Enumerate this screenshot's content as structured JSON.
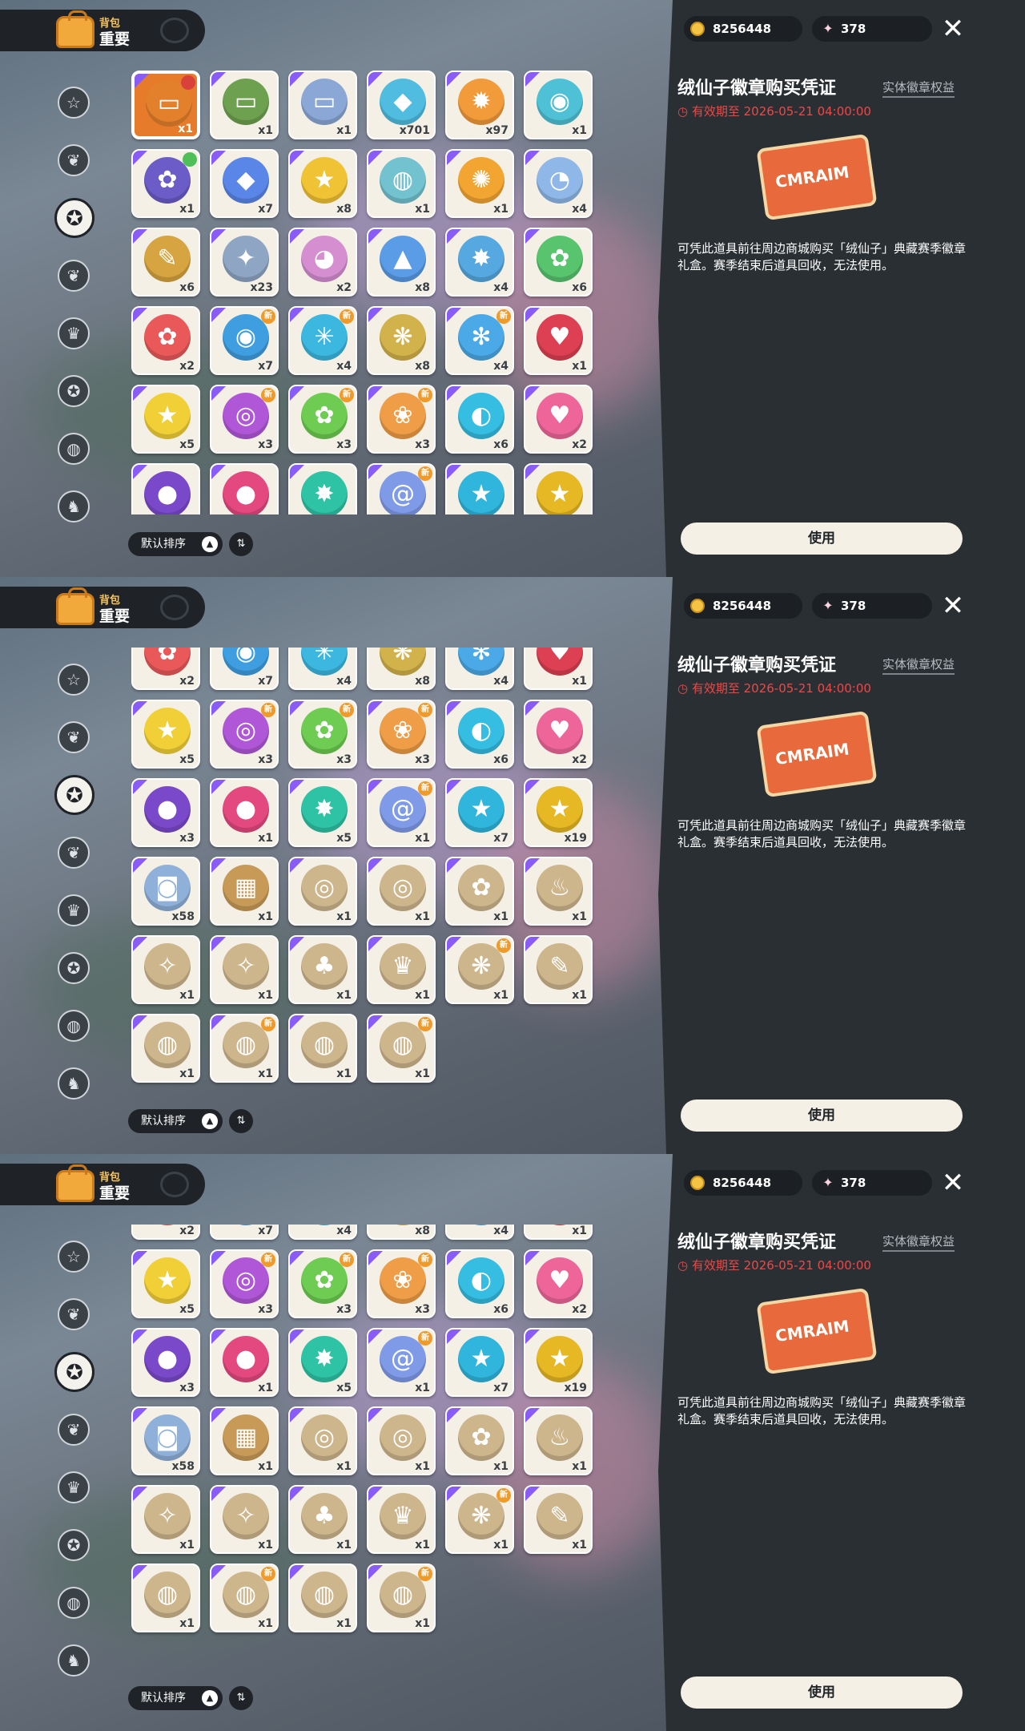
{
  "header": {
    "bag_label": "背包",
    "category": "重要"
  },
  "currency": {
    "coins": "8256448",
    "gems": "378"
  },
  "close_icon": "✕",
  "sort": {
    "label": "默认排序",
    "arrow": "▲",
    "order_icon": "⇅"
  },
  "detail": {
    "title": "绒仙子徽章购买凭证",
    "tag": "实体徽章权益",
    "expire": "有效期至 2026-05-21 04:00:00",
    "art_label": "CMRAIM",
    "description": "可凭此道具前往周边商城购买「绒仙子」典藏赛季徽章礼盒。赛季结束后道具回收，无法使用。",
    "use_button": "使用"
  },
  "sidebar_icons": [
    "☆",
    "❦",
    "✪",
    "❦",
    "♛",
    "✪",
    "◍",
    "♞"
  ],
  "rows": [
    {
      "items": [
        {
          "c": "#e3802c",
          "i": "▭",
          "n": "x1",
          "sel": true,
          "b": "red"
        },
        {
          "c": "#6ea14f",
          "i": "▭",
          "n": "x1"
        },
        {
          "c": "#8aa7d6",
          "i": "▭",
          "n": "x1"
        },
        {
          "c": "#4fbce0",
          "i": "◆",
          "n": "x701"
        },
        {
          "c": "#f19b3a",
          "i": "✹",
          "n": "x97"
        },
        {
          "c": "#4fc1d6",
          "i": "◉",
          "n": "x1"
        }
      ]
    },
    {
      "items": [
        {
          "c": "#6b5cc8",
          "i": "✿",
          "n": "x1",
          "b": "green"
        },
        {
          "c": "#5a86e8",
          "i": "◆",
          "n": "x7"
        },
        {
          "c": "#f0c334",
          "i": "★",
          "n": "x8"
        },
        {
          "c": "#72c2cf",
          "i": "◍",
          "n": "x1"
        },
        {
          "c": "#f3a532",
          "i": "✺",
          "n": "x1"
        },
        {
          "c": "#8fb8e8",
          "i": "◔",
          "n": "x4"
        }
      ]
    },
    {
      "items": [
        {
          "c": "#d6a440",
          "i": "✎",
          "n": "x6"
        },
        {
          "c": "#8ea5c4",
          "i": "✦",
          "n": "x23"
        },
        {
          "c": "#d58fd1",
          "i": "◕",
          "n": "x2"
        },
        {
          "c": "#5a9ce6",
          "i": "▲",
          "n": "x8"
        },
        {
          "c": "#55a8e0",
          "i": "✸",
          "n": "x4"
        },
        {
          "c": "#58c46e",
          "i": "✿",
          "n": "x6"
        }
      ]
    },
    {
      "items": [
        {
          "c": "#e9595a",
          "i": "✿",
          "n": "x2"
        },
        {
          "c": "#3f9ee0",
          "i": "◉",
          "n": "x7",
          "b": "new"
        },
        {
          "c": "#3cb8e0",
          "i": "✳",
          "n": "x4",
          "b": "new"
        },
        {
          "c": "#d2b24a",
          "i": "❋",
          "n": "x8"
        },
        {
          "c": "#4aa9e6",
          "i": "✻",
          "n": "x4",
          "b": "new"
        },
        {
          "c": "#dc4052",
          "i": "♥",
          "n": "x1"
        }
      ]
    },
    {
      "items": [
        {
          "c": "#f1cf37",
          "i": "★",
          "n": "x5"
        },
        {
          "c": "#b057d8",
          "i": "◎",
          "n": "x3",
          "b": "new"
        },
        {
          "c": "#6ecc52",
          "i": "✿",
          "n": "x3",
          "b": "new"
        },
        {
          "c": "#ef9d46",
          "i": "❀",
          "n": "x3",
          "b": "new"
        },
        {
          "c": "#36bde2",
          "i": "◐",
          "n": "x6"
        },
        {
          "c": "#ee6699",
          "i": "♥",
          "n": "x2"
        }
      ]
    },
    {
      "items": [
        {
          "c": "#7a49c9",
          "i": "●",
          "n": "x3"
        },
        {
          "c": "#e3487e",
          "i": "●",
          "n": "x1"
        },
        {
          "c": "#2fc3a6",
          "i": "✸",
          "n": "x5"
        },
        {
          "c": "#7f9be8",
          "i": "@",
          "n": "x1",
          "b": "new"
        },
        {
          "c": "#30b6dd",
          "i": "★",
          "n": "x7"
        },
        {
          "c": "#e6b823",
          "i": "★",
          "n": "x19"
        }
      ]
    },
    {
      "items": [
        {
          "c": "#8fb0d8",
          "i": "◙",
          "n": "x58"
        },
        {
          "c": "#c79a58",
          "i": "▦",
          "n": "x1"
        },
        {
          "c": "#cdb58c",
          "i": "◎",
          "n": "x1"
        },
        {
          "c": "#cdb58c",
          "i": "◎",
          "n": "x1"
        },
        {
          "c": "#cdb58c",
          "i": "✿",
          "n": "x1"
        },
        {
          "c": "#cdb58c",
          "i": "♨",
          "n": "x1"
        }
      ]
    },
    {
      "items": [
        {
          "c": "#cdb58c",
          "i": "✧",
          "n": "x1"
        },
        {
          "c": "#cdb58c",
          "i": "✧",
          "n": "x1"
        },
        {
          "c": "#cdb58c",
          "i": "♣",
          "n": "x1"
        },
        {
          "c": "#cdb58c",
          "i": "♛",
          "n": "x1"
        },
        {
          "c": "#cdb58c",
          "i": "❋",
          "n": "x1",
          "b": "new"
        },
        {
          "c": "#cdb58c",
          "i": "✎",
          "n": "x1"
        }
      ]
    },
    {
      "items": [
        {
          "c": "#cdb58c",
          "i": "◍",
          "n": "x1"
        },
        {
          "c": "#cdb58c",
          "i": "◍",
          "n": "x1",
          "b": "new"
        },
        {
          "c": "#cdb58c",
          "i": "◍",
          "n": "x1"
        },
        {
          "c": "#cdb58c",
          "i": "◍",
          "n": "x1",
          "b": "new"
        }
      ]
    }
  ],
  "screens": [
    {
      "first_row": 0,
      "offset": 0
    },
    {
      "first_row": 3,
      "offset": -33
    },
    {
      "first_row": 3,
      "offset": -67
    }
  ],
  "badge_new": "新"
}
